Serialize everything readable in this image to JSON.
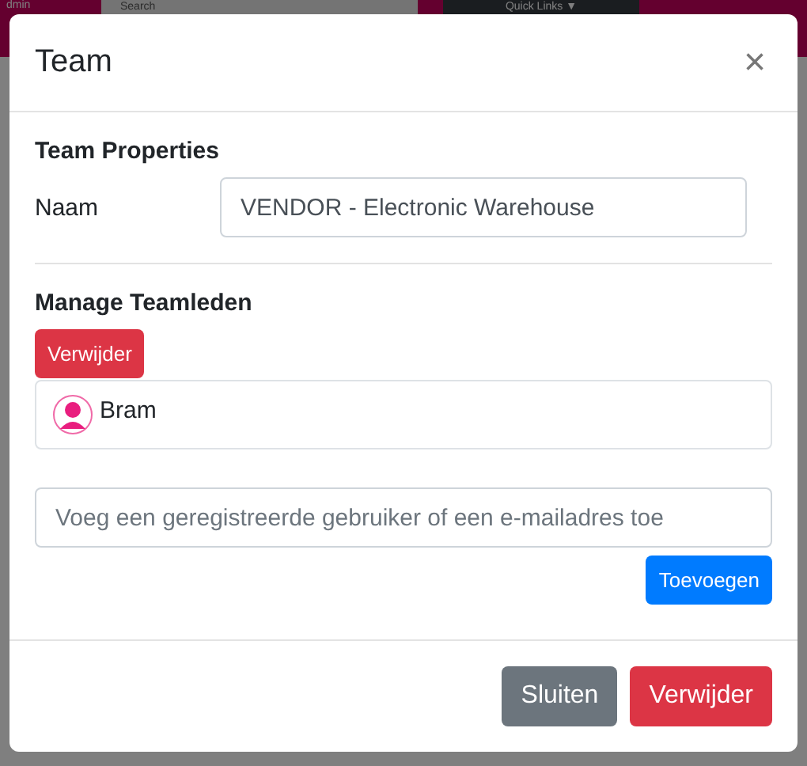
{
  "background": {
    "nav_text": "dmin",
    "search": {
      "placeholder": "Search"
    },
    "quick_links": "Quick Links ▼"
  },
  "modal": {
    "title": "Team",
    "close": "×",
    "section_1": {
      "heading": "Team Properties",
      "name_label": "Naam",
      "name_value": "VENDOR - Electronic Warehouse"
    },
    "section_2": {
      "heading": "Manage Teamleden",
      "remove_button": "Verwijder",
      "members": [
        {
          "name": "Bram"
        }
      ],
      "add_field": {
        "placeholder": "Voeg een geregistreerde gebruiker of een e-mailadres toe"
      },
      "add_button": "Toevoegen"
    },
    "footer": {
      "buttons": [
        {
          "label": "Sluiten",
          "kind": "secondary"
        },
        {
          "label": "Verwijder",
          "kind": "danger"
        }
      ]
    }
  }
}
